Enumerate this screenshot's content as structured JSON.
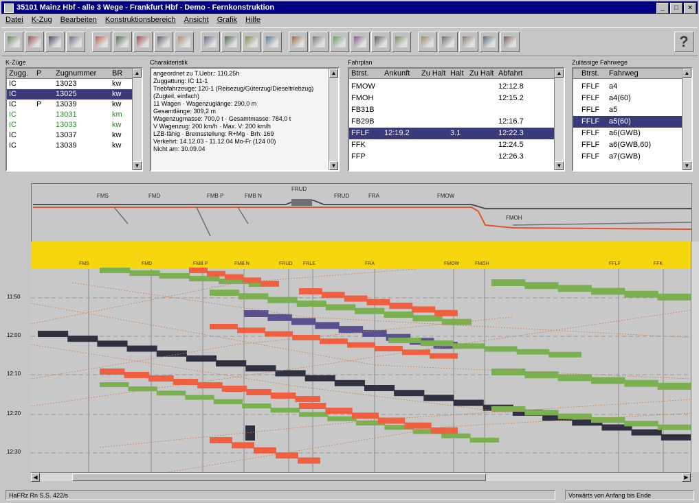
{
  "window": {
    "title": "35101 Mainz Hbf - alle 3 Wege - Frankfurt Hbf - Demo - Fernkonstruktion"
  },
  "menu": [
    "Datei",
    "K-Zug",
    "Bearbeiten",
    "Konstruktionsbereich",
    "Ansicht",
    "Grafik",
    "Hilfe"
  ],
  "panels": {
    "kzuege": {
      "label": "K-Züge",
      "headers": [
        "Zugg.",
        "P",
        "Zugnummer",
        "BR"
      ],
      "rows": [
        {
          "gattung": "IC",
          "p": "",
          "nummer": "13023",
          "br": "kw",
          "color": "#000000"
        },
        {
          "gattung": "IC",
          "p": "",
          "nummer": "13025",
          "br": "kw",
          "color": "#ffffff"
        },
        {
          "gattung": "IC",
          "p": "P",
          "nummer": "13039",
          "br": "kw",
          "color": "#000000"
        },
        {
          "gattung": "IC",
          "p": "",
          "nummer": "13031",
          "br": "km",
          "color": "#2a8a2a"
        },
        {
          "gattung": "IC",
          "p": "",
          "nummer": "13033",
          "br": "kw",
          "color": "#2a8a2a"
        },
        {
          "gattung": "IC",
          "p": "",
          "nummer": "13037",
          "br": "kw",
          "color": "#000000"
        },
        {
          "gattung": "IC",
          "p": "",
          "nummer": "13039",
          "br": "kw",
          "color": "#000000"
        }
      ]
    },
    "charakteristik": {
      "label": "Charakteristik",
      "lines": [
        "angeordnet zu T.Uebr.: 110,25h",
        "Zuggattung: IC 11-1",
        "Triebfahrzeuge: 120-1 (Reisezug/Güterzug/Dieseltriebzug)",
        "(Zugteil, einfach)",
        "11 Wagen · Wagenzuglänge: 290,0 m",
        "Gesamtlänge: 309,2 m",
        "Wagenzugmasse: 700,0 t · Gesamtmasse: 784,0 t",
        "V Wagenzug: 200 km/h · Max. V: 200 km/h",
        "LZB-fähig · Bremsstellung: R+Mg · Brh: 169",
        "Verkehrt: 14.12.03 - 11.12.04 Mo-Fr (124 00)",
        "Nicht am: 30.09.04"
      ]
    },
    "fahrplan": {
      "label": "Fahrplan",
      "headers": [
        "Btrst.",
        "Ankunft",
        "Zu Halt",
        "Halt",
        "Zu Halt",
        "Abfahrt"
      ],
      "rows": [
        {
          "btrst": "FMOW",
          "ankunft": "",
          "zuhalt": "",
          "halt": "",
          "zuhalt2": "",
          "abfahrt": "12:12.8"
        },
        {
          "btrst": "FMOH",
          "ankunft": "",
          "zuhalt": "",
          "halt": "",
          "zuhalt2": "",
          "abfahrt": "12:15.2"
        },
        {
          "btrst": "FB31B",
          "ankunft": "",
          "zuhalt": "",
          "halt": "",
          "zuhalt2": "",
          "abfahrt": ""
        },
        {
          "btrst": "FB29B",
          "ankunft": "",
          "zuhalt": "",
          "halt": "",
          "zuhalt2": "",
          "abfahrt": "12:16.7"
        },
        {
          "btrst": "FFLF",
          "ankunft": "12:19.2",
          "zuhalt": "",
          "halt": "3.1",
          "zuhalt2": "",
          "abfahrt": "12:22.3"
        },
        {
          "btrst": "FFK",
          "ankunft": "",
          "zuhalt": "",
          "halt": "",
          "zuhalt2": "",
          "abfahrt": "12:24.5"
        },
        {
          "btrst": "FFP",
          "ankunft": "",
          "zuhalt": "",
          "halt": "",
          "zuhalt2": "",
          "abfahrt": "12:26.3"
        }
      ]
    },
    "fahrwege": {
      "label": "Zulässige Fahrwege",
      "headers": [
        "Btrst.",
        "Fahrweg"
      ],
      "rows": [
        {
          "btrst": "FFLF",
          "weg": "a4"
        },
        {
          "btrst": "FFLF",
          "weg": "a4(60)"
        },
        {
          "btrst": "FFLF",
          "weg": "a5"
        },
        {
          "btrst": "FFLF",
          "weg": "a5(60)"
        },
        {
          "btrst": "FFLF",
          "weg": "a6(GWB)"
        },
        {
          "btrst": "FFLF",
          "weg": "a6(GWB,60)"
        },
        {
          "btrst": "FFLF",
          "weg": "a7(GWB)"
        }
      ]
    }
  },
  "overview": {
    "stations": [
      "FMS",
      "FMD",
      "FMB P",
      "FMB N",
      "FRUD",
      "FRUD",
      "FRA",
      "FMOW",
      "FMOH"
    ]
  },
  "graph": {
    "stations": [
      "FMS",
      "FMD",
      "FMB P",
      "FMB N",
      "FRUD",
      "FRLE",
      "FRA",
      "FMOW",
      "FMOH",
      "FFLF",
      "FFK"
    ],
    "times": [
      "11:50",
      "12:00",
      "12:10",
      "12:20",
      "12:30"
    ]
  },
  "status": {
    "left": "HaFRz Rn S.S. 422/s",
    "right": "Vorwärts von Anfang bis Ende"
  },
  "colors": {
    "titlebar": "#000080",
    "selection": "#3a3a7a",
    "stationbar": "#f5d60f",
    "train_red": "#f06040",
    "train_green": "#7ab050",
    "train_dark": "#303040",
    "train_purple": "#5a5090"
  }
}
